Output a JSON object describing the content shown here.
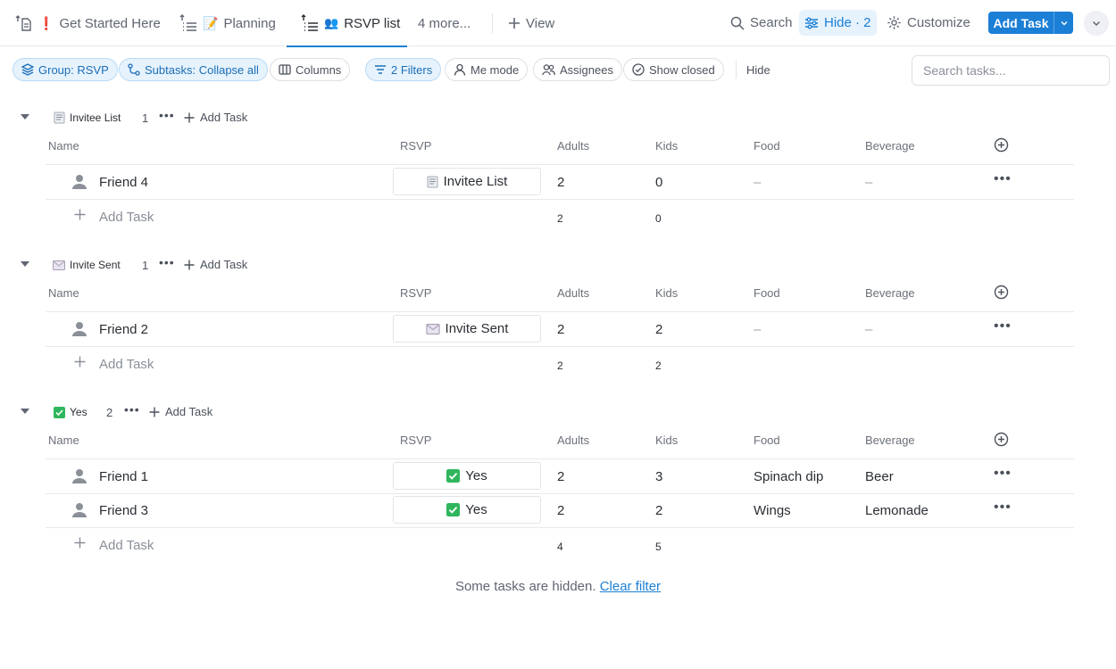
{
  "topbar": {
    "tabs": [
      {
        "label": "Get Started Here",
        "emoji": "❗"
      },
      {
        "label": "Planning",
        "emoji": "📝"
      },
      {
        "label": "RSVP list",
        "emoji": "👥"
      }
    ],
    "more_label": "4 more...",
    "view_label": "View",
    "search_label": "Search",
    "hide_label": "Hide · 2",
    "customize_label": "Customize",
    "add_task_label": "Add Task"
  },
  "filters": {
    "group": "Group: RSVP",
    "subtasks": "Subtasks: Collapse all",
    "columns": "Columns",
    "filters": "2 Filters",
    "me_mode": "Me mode",
    "assignees": "Assignees",
    "show_closed": "Show closed",
    "hide": "Hide",
    "search_placeholder": "Search tasks..."
  },
  "columns": {
    "name": "Name",
    "rsvp": "RSVP",
    "adults": "Adults",
    "kids": "Kids",
    "food": "Food",
    "beverage": "Beverage"
  },
  "add_task_label": "Add Task",
  "groups": [
    {
      "name": "Invitee List",
      "icon": "notepad-icon",
      "count": "1",
      "tasks": [
        {
          "name": "Friend 4",
          "rsvp": "Invitee List",
          "adults": "2",
          "kids": "0",
          "food": "–",
          "beverage": "–"
        }
      ],
      "sum_adults": "2",
      "sum_kids": "0"
    },
    {
      "name": "Invite Sent",
      "icon": "envelope-icon",
      "count": "1",
      "tasks": [
        {
          "name": "Friend 2",
          "rsvp": "Invite Sent",
          "adults": "2",
          "kids": "2",
          "food": "–",
          "beverage": "–"
        }
      ],
      "sum_adults": "2",
      "sum_kids": "2"
    },
    {
      "name": "Yes",
      "icon": "green-check-icon",
      "count": "2",
      "tasks": [
        {
          "name": "Friend 1",
          "rsvp": "Yes",
          "adults": "2",
          "kids": "3",
          "food": "Spinach dip",
          "beverage": "Beer"
        },
        {
          "name": "Friend 3",
          "rsvp": "Yes",
          "adults": "2",
          "kids": "2",
          "food": "Wings",
          "beverage": "Lemonade"
        }
      ],
      "sum_adults": "4",
      "sum_kids": "5"
    }
  ],
  "footer": {
    "hidden_text": "Some tasks are hidden.",
    "clear_filter": "Clear filter"
  }
}
